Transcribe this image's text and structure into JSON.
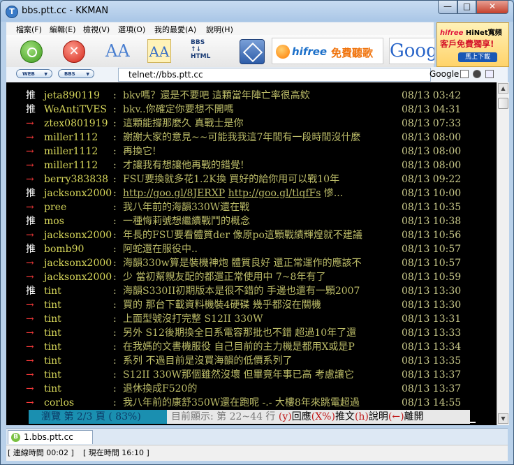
{
  "window": {
    "title": "bbs.ptt.cc - KKMAN",
    "app_glyph": "T"
  },
  "window_buttons": {
    "minimize": "—",
    "maximize": "□",
    "close": "✕"
  },
  "menu": [
    "檔案(F)",
    "編輯(E)",
    "檢視(V)",
    "選項(O)",
    "我的最愛(A)",
    "說明(H)"
  ],
  "toolbar": {
    "stop_glyph": "✕",
    "font_large": "AA",
    "font_small": "AA",
    "bbs_html_l1": "BBS",
    "bbs_html_l2": "↑↓",
    "bbs_html_l3": "HTML",
    "hifree_brand": "hifree",
    "hifree_slogan": "免費聽歌",
    "google_logo": "Goog"
  },
  "ad": {
    "line1": "HiNet寬頻",
    "line1_brand": "hifree",
    "line2": "客戶免費獨享!",
    "button": "馬上下載"
  },
  "addressbar": {
    "pill1": "WEB",
    "pill2": "BBS",
    "url": "telnet://bbs.ptt.cc",
    "search_label": "Google"
  },
  "terminal": {
    "rows": [
      {
        "tag": "推",
        "kind": "push",
        "user": "jeta890119",
        "msg": "bkv嗎？還是不要吧 這顆當年陣亡率很高欸",
        "time": "08/13 03:42"
      },
      {
        "tag": "推",
        "kind": "push",
        "user": "WeAntiTVES",
        "msg": "bkv..你確定你要想不開嗎",
        "time": "08/13 04:31"
      },
      {
        "tag": "→",
        "kind": "arrow",
        "user": "ztex0801919",
        "msg": "這顆能撐那麼久 真戰士是你",
        "time": "08/13 07:33"
      },
      {
        "tag": "→",
        "kind": "arrow",
        "user": "miller1112",
        "msg": "謝謝大家的意見~~可能我我這7年間有一段時間沒什麼",
        "time": "08/13 08:00"
      },
      {
        "tag": "→",
        "kind": "arrow",
        "user": "miller1112",
        "msg": "再換它!",
        "time": "08/13 08:00"
      },
      {
        "tag": "→",
        "kind": "arrow",
        "user": "miller1112",
        "msg": "才讓我有想讓他再戰的錯覺!",
        "time": "08/13 08:00"
      },
      {
        "tag": "→",
        "kind": "arrow",
        "user": "berry383838",
        "msg": "FSU要換就多花1.2K換 買好的給你用可以戰10年",
        "time": "08/13 09:22"
      },
      {
        "tag": "推",
        "kind": "push",
        "user": "jacksonx2000",
        "msg": "",
        "link1": "http://goo.gl/8JERXP",
        "link2": "http://goo.gl/tlqfFs",
        "msg_tail": " 慘...",
        "time": "08/13 10:00"
      },
      {
        "tag": "→",
        "kind": "arrow",
        "user": "pree",
        "msg": "我八年前的海韻330W還在戰",
        "time": "08/13 10:35"
      },
      {
        "tag": "推",
        "kind": "push",
        "user": "mos",
        "msg": "一種悔莉號想繼續戰鬥的概念",
        "time": "08/13 10:38"
      },
      {
        "tag": "→",
        "kind": "arrow",
        "user": "jacksonx2000",
        "msg": "年長的FSU要看體質der 像原po這顆戰績輝煌就不建議",
        "time": "08/13 10:56"
      },
      {
        "tag": "推",
        "kind": "push",
        "user": "bomb90",
        "msg": "阿蛇還在服役中..",
        "time": "08/13 10:57"
      },
      {
        "tag": "→",
        "kind": "arrow",
        "user": "jacksonx2000",
        "msg": "海韻330w算是裝機神炮 體質良好 還正常運作的應該不",
        "time": "08/13 10:57"
      },
      {
        "tag": "→",
        "kind": "arrow",
        "user": "jacksonx2000",
        "msg": "少 當初幫親友配的都還正常使用中 7~8年有了",
        "time": "08/13 10:59"
      },
      {
        "tag": "推",
        "kind": "push",
        "user": "tint",
        "msg": "海韻S330II初期版本是很不錯的 手邊也還有一顆2007",
        "time": "08/13 13:30"
      },
      {
        "tag": "→",
        "kind": "arrow",
        "user": "tint",
        "msg": "買的 那台下載資料機裝4硬碟 幾乎都沒在關機",
        "time": "08/13 13:30"
      },
      {
        "tag": "→",
        "kind": "arrow",
        "user": "tint",
        "msg": "上面型號沒打完整 S12II 330W",
        "time": "08/13 13:31"
      },
      {
        "tag": "→",
        "kind": "arrow",
        "user": "tint",
        "msg": "另外 S12後期換全日系電容那批也不錯 超過10年了還",
        "time": "08/13 13:33"
      },
      {
        "tag": "→",
        "kind": "arrow",
        "user": "tint",
        "msg": "在我媽的文書機服役 自己目前的主力機是都用X或是P",
        "time": "08/13 13:34"
      },
      {
        "tag": "→",
        "kind": "arrow",
        "user": "tint",
        "msg": "系列 不過目前是沒買海韻的低價系列了",
        "time": "08/13 13:35"
      },
      {
        "tag": "→",
        "kind": "arrow",
        "user": "tint",
        "msg": "S12II 330W那個雖然沒壞 但畢竟年事已高 考慮讓它",
        "time": "08/13 13:37"
      },
      {
        "tag": "→",
        "kind": "arrow",
        "user": "tint",
        "msg": "退休換成F520的",
        "time": "08/13 13:37"
      },
      {
        "tag": "→",
        "kind": "arrow",
        "user": "corlos",
        "msg": "我八年前的康舒350W還在跑呢 -.- 大樓8年來跳電超過",
        "time": "08/13 14:55"
      }
    ],
    "status": {
      "left": "瀏覽 第 2/3 頁 ( 83%)",
      "info": "目前顯示: 第 22~44 行",
      "key_y": "(y)",
      "txt_y": "回應",
      "key_x": "(X%)",
      "txt_x": "推文",
      "key_h": "(h)",
      "txt_h": "說明",
      "key_b": "(←)",
      "txt_b": "離開"
    }
  },
  "scrollbar": {
    "up": "▲",
    "down": "▼"
  },
  "tab": {
    "label": "1.bbs.ptt.cc",
    "icon_glyph": "B"
  },
  "statusbar": {
    "connect": "[ 連線時間 00:02 ]",
    "now": "[ 現在時間 16:10 ]"
  }
}
